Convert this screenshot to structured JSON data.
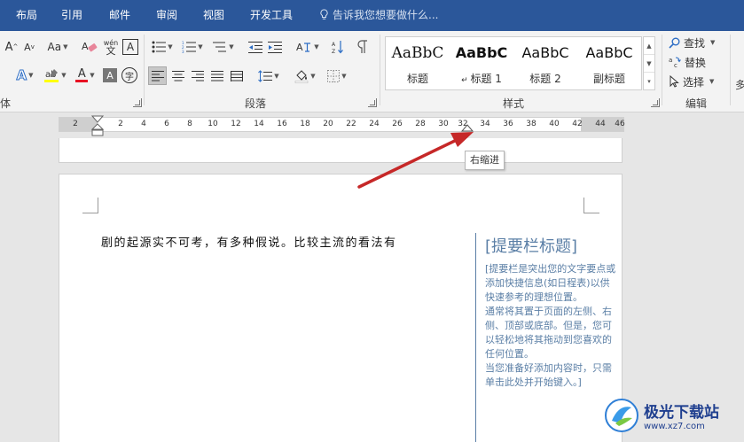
{
  "tabs": [
    {
      "label": "布局"
    },
    {
      "label": "引用"
    },
    {
      "label": "邮件"
    },
    {
      "label": "审阅"
    },
    {
      "label": "视图"
    },
    {
      "label": "开发工具"
    }
  ],
  "tell_me": "告诉我您想要做什么...",
  "ribbon": {
    "groups": {
      "font_partial": "体",
      "paragraph": "段落",
      "styles": "样式",
      "editing": "编辑",
      "next_partial": "多"
    },
    "font": {
      "grow_label": "A",
      "shrink_label": "A",
      "case_label": "Aa",
      "phonetic_label": "wén",
      "char_border_label": "A",
      "text_effect_label": "A",
      "font_color_label": "A",
      "char_shading_label": "A",
      "enclose_label": "字",
      "highlight_color": "#ffff00",
      "font_color": "#e81123"
    },
    "styles": [
      {
        "sample": "AaBbC",
        "name": "标题",
        "bold": false
      },
      {
        "sample": "AaBbC",
        "name": "标题 1",
        "bold": true
      },
      {
        "sample": "AaBbC",
        "name": "标题 2",
        "bold": false
      },
      {
        "sample": "AaBbC",
        "name": "副标题",
        "bold": false
      }
    ],
    "editing": {
      "find": "查找",
      "replace": "替换",
      "select": "选择"
    }
  },
  "ruler": {
    "numbers": [
      "2",
      "2",
      "4",
      "6",
      "8",
      "10",
      "12",
      "14",
      "16",
      "18",
      "20",
      "22",
      "24",
      "26",
      "28",
      "30",
      "32",
      "34",
      "36",
      "38",
      "40",
      "42",
      "44",
      "46"
    ]
  },
  "tooltip": "右缩进",
  "document": {
    "body": "剧的起源实不可考，有多种假说。比较主流的看法有",
    "sidebar_title": "[提要栏标题]",
    "sidebar_paragraphs": [
      "[提要栏是突出您的文字要点或添加快捷信息(如日程表)以供快速参考的理想位置。",
      "通常将其置于页面的左侧、右侧、顶部或底部。但是，您可以轻松地将其拖动到您喜欢的任何位置。",
      "当您准备好添加内容时，只需单击此处并开始键入。]"
    ]
  },
  "watermark": {
    "name": "极光下载站",
    "url": "www.xz7.com"
  },
  "colors": {
    "tab_bar": "#2b579a",
    "sidebar_accent": "#5b7fa6",
    "arrow": "#d32f2f"
  }
}
